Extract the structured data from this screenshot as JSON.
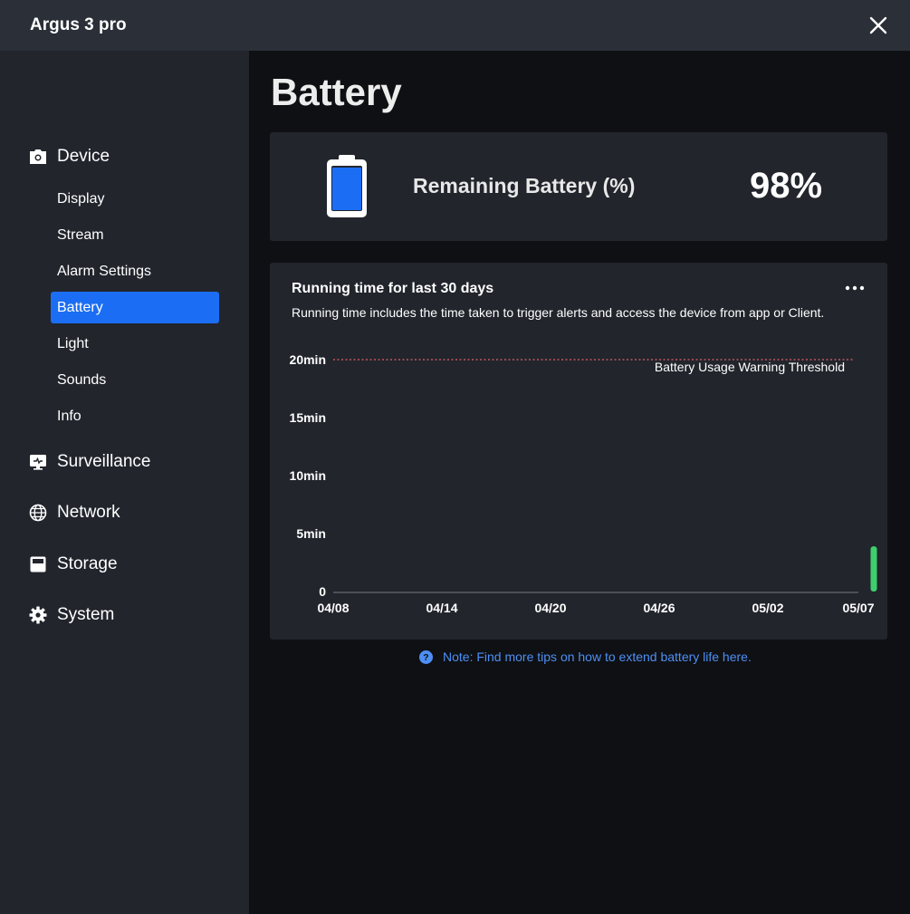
{
  "window": {
    "title": "Argus 3 pro"
  },
  "sidebar": {
    "groups": [
      {
        "label": "Device",
        "icon": "camera-icon"
      },
      {
        "label": "Surveillance",
        "icon": "monitor-icon"
      },
      {
        "label": "Network",
        "icon": "globe-icon"
      },
      {
        "label": "Storage",
        "icon": "storage-icon"
      },
      {
        "label": "System",
        "icon": "gear-icon"
      }
    ],
    "device_items": [
      {
        "label": "Display"
      },
      {
        "label": "Stream"
      },
      {
        "label": "Alarm Settings"
      },
      {
        "label": "Battery",
        "active": true
      },
      {
        "label": "Light"
      },
      {
        "label": "Sounds"
      },
      {
        "label": "Info"
      }
    ]
  },
  "main": {
    "title": "Battery",
    "battery": {
      "label": "Remaining Battery (%)",
      "value": "98%",
      "level": 0.98
    },
    "chart_card": {
      "title": "Running time for last 30 days",
      "description": "Running time includes the time taken to trigger alerts and access the device from app or Client."
    },
    "note": "Note: Find more tips on how to extend battery life here."
  },
  "colors": {
    "accent": "#1b6ef3",
    "bar": "#3ecf6e",
    "threshold": "#c0565e",
    "battery_fill": "#1b6ef3"
  },
  "chart_data": {
    "type": "bar",
    "x_tick_labels": [
      "04/08",
      "04/14",
      "04/20",
      "04/26",
      "05/02",
      "05/07"
    ],
    "y_tick_labels": [
      "0",
      "5min",
      "10min",
      "15min",
      "20min"
    ],
    "y_ticks_minutes": [
      0,
      5,
      10,
      15,
      20
    ],
    "ylim_minutes": [
      0,
      20
    ],
    "x_range": [
      "04/08",
      "05/07"
    ],
    "series": [
      {
        "points": [
          {
            "x": "05/07",
            "y_minutes": 3.9
          }
        ]
      }
    ],
    "threshold": {
      "label": "Battery Usage Warning Threshold",
      "y_minutes": 20
    },
    "grid": false
  }
}
